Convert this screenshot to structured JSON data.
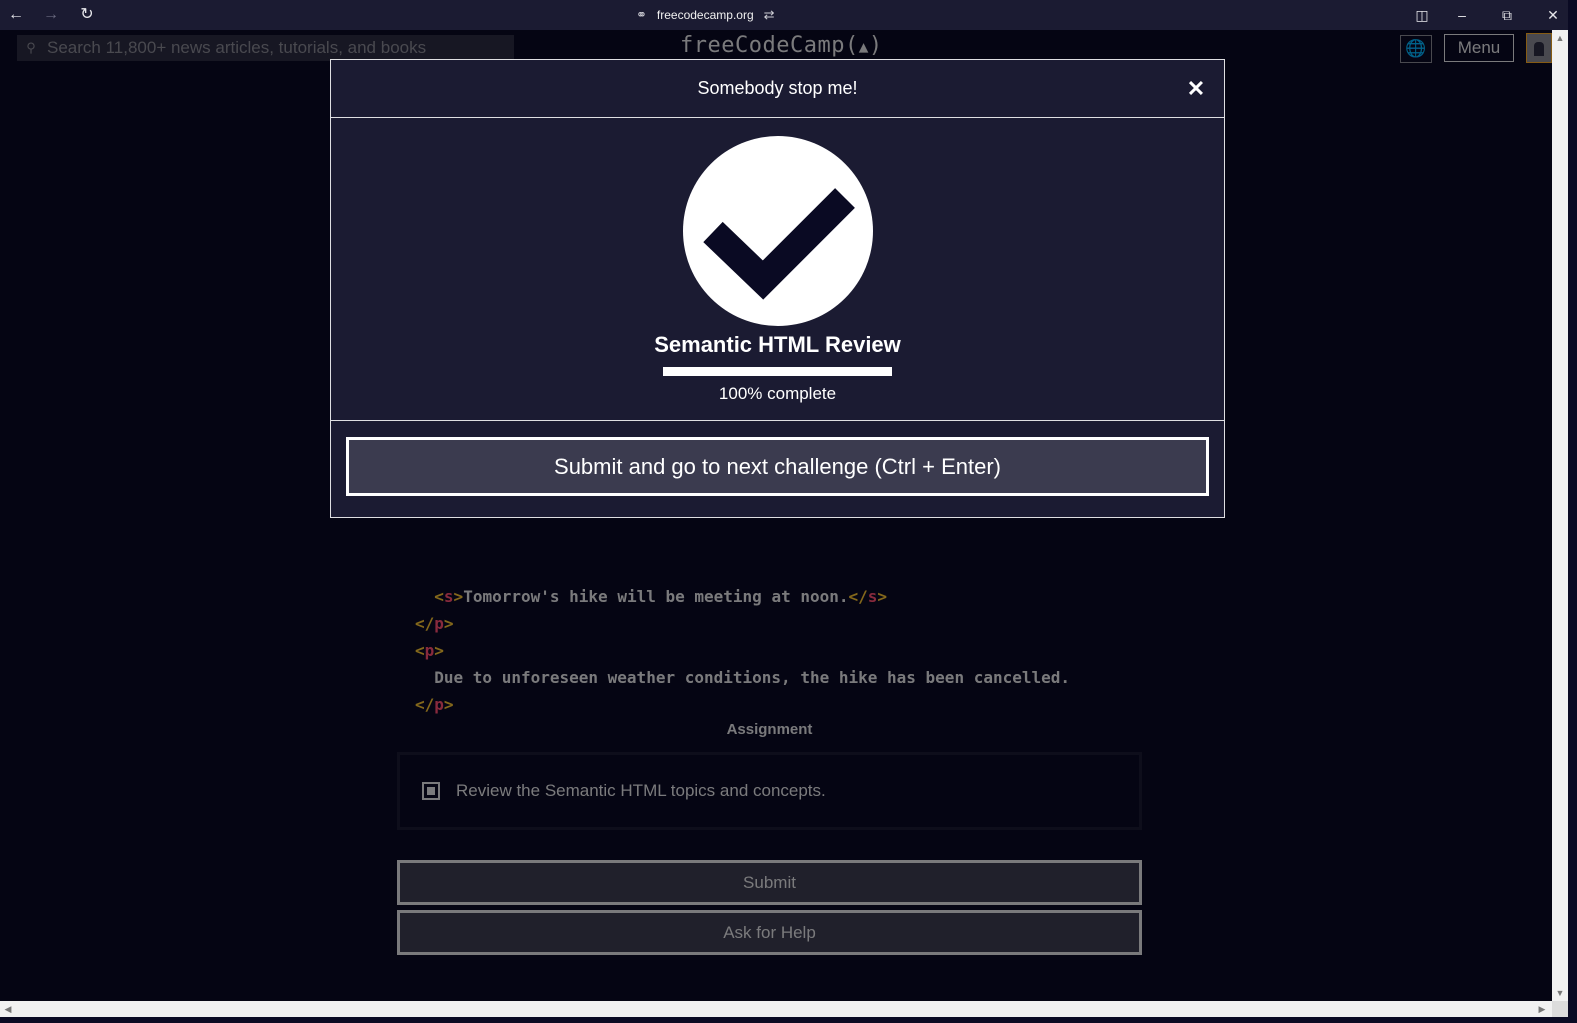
{
  "browser": {
    "url": "freecodecamp.org",
    "back_icon": "arrow-left-icon",
    "forward_icon": "arrow-right-icon",
    "reload_icon": "reload-icon"
  },
  "navbar": {
    "search_placeholder": "Search 11,800+ news articles, tutorials, and books",
    "logo_text": "freeCodeCamp(",
    "logo_flame": "🔥",
    "logo_close": ")",
    "menu_label": "Menu"
  },
  "code": {
    "lines": [
      {
        "indent": "  ",
        "open": "<s>",
        "text": "Tomorrow's hike will be meeting at noon.",
        "close": "</s>"
      },
      {
        "indent": "",
        "open": "",
        "text": "",
        "close": "</p>"
      },
      {
        "indent": "",
        "open": "<p>",
        "text": "",
        "close": ""
      },
      {
        "indent": "  ",
        "open": "",
        "text": "Due to unforeseen weather conditions, the hike has been cancelled.",
        "close": ""
      },
      {
        "indent": "",
        "open": "",
        "text": "",
        "close": "</p>"
      }
    ]
  },
  "assignment": {
    "title": "Assignment",
    "task": "Review the Semantic HTML topics and concepts.",
    "checked": true
  },
  "buttons": {
    "submit": "Submit",
    "help": "Ask for Help"
  },
  "modal": {
    "title": "Somebody stop me!",
    "close_label": "×",
    "block_title": "Semantic HTML Review",
    "progress_percent": 100,
    "progress_text": "100% complete",
    "submit_next": "Submit and go to next challenge (Ctrl + Enter)"
  }
}
